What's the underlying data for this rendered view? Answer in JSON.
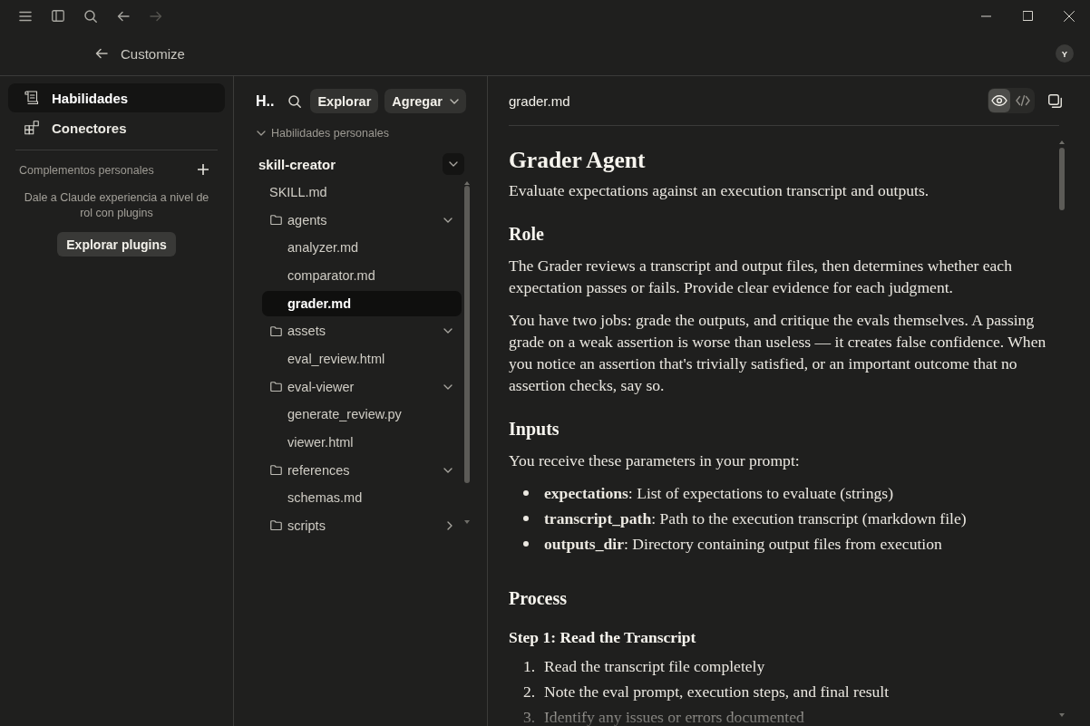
{
  "titlebar": {
    "navigation": [
      {
        "kind": "back",
        "disabled": false
      },
      {
        "kind": "forward",
        "disabled": true
      }
    ]
  },
  "header": {
    "title": "Customize",
    "avatar": "Y"
  },
  "sidebar": {
    "items": [
      {
        "kind": "skills",
        "label": "Habilidades",
        "selected": true
      },
      {
        "kind": "connectors",
        "label": "Conectores",
        "selected": false
      }
    ],
    "section": {
      "title": "Complementos personales",
      "description": "Dale a Claude experiencia a nivel de rol con plugins",
      "button": "Explorar plugins"
    }
  },
  "skills_panel": {
    "title": "H..",
    "buttons": [
      {
        "kind": "plain",
        "label": "Explorar"
      },
      {
        "kind": "dropdown",
        "label": "Agregar"
      }
    ],
    "group": {
      "label": "Habilidades personales",
      "expanded": true
    },
    "skill": {
      "name": "skill-creator",
      "expanded": true
    },
    "tree": [
      {
        "kind": "file",
        "name": "SKILL.md",
        "selected": false
      },
      {
        "kind": "folder",
        "name": "agents",
        "expanded": true,
        "selected": false,
        "children": [
          {
            "kind": "file",
            "name": "analyzer.md",
            "selected": false
          },
          {
            "kind": "file",
            "name": "comparator.md",
            "selected": false
          },
          {
            "kind": "file",
            "name": "grader.md",
            "selected": true
          }
        ]
      },
      {
        "kind": "folder",
        "name": "assets",
        "expanded": true,
        "selected": false,
        "children": [
          {
            "kind": "file",
            "name": "eval_review.html",
            "selected": false
          }
        ]
      },
      {
        "kind": "folder",
        "name": "eval-viewer",
        "expanded": true,
        "selected": false,
        "children": [
          {
            "kind": "file",
            "name": "generate_review.py",
            "selected": false
          },
          {
            "kind": "file",
            "name": "viewer.html",
            "selected": false
          }
        ]
      },
      {
        "kind": "folder",
        "name": "references",
        "expanded": true,
        "selected": false,
        "children": [
          {
            "kind": "file",
            "name": "schemas.md",
            "selected": false
          }
        ]
      },
      {
        "kind": "folder",
        "name": "scripts",
        "expanded": false,
        "selected": false
      }
    ]
  },
  "document": {
    "filename": "grader.md",
    "view_modes": [
      {
        "kind": "preview",
        "selected": true
      },
      {
        "kind": "code",
        "selected": false
      }
    ],
    "blocks": [
      {
        "kind": "h1",
        "text": "Grader Agent"
      },
      {
        "kind": "p",
        "text": "Evaluate expectations against an execution transcript and outputs."
      },
      {
        "kind": "h2",
        "text": "Role"
      },
      {
        "kind": "p",
        "text": "The Grader reviews a transcript and output files, then determines whether each expectation passes or fails. Provide clear evidence for each judgment."
      },
      {
        "kind": "p",
        "text": "You have two jobs: grade the outputs, and critique the evals themselves. A passing grade on a weak assertion is worse than useless — it creates false confidence. When you notice an assertion that's trivially satisfied, or an important outcome that no assertion checks, say so."
      },
      {
        "kind": "h2",
        "text": "Inputs"
      },
      {
        "kind": "p",
        "text": "You receive these parameters in your prompt:"
      },
      {
        "kind": "bullets",
        "items": [
          "**expectations**: List of expectations to evaluate (strings)",
          "**transcript_path**: Path to the execution transcript (markdown file)",
          "**outputs_dir**: Directory containing output files from execution"
        ]
      },
      {
        "kind": "h2",
        "text": "Process"
      },
      {
        "kind": "h3",
        "text": "Step 1: Read the Transcript"
      },
      {
        "kind": "numbered",
        "items": [
          {
            "number": "1.",
            "text": "Read the transcript file completely"
          },
          {
            "number": "2.",
            "text": "Note the eval prompt, execution steps, and final result"
          },
          {
            "number": "3.",
            "text": "Identify any issues or errors documented"
          }
        ]
      }
    ]
  }
}
